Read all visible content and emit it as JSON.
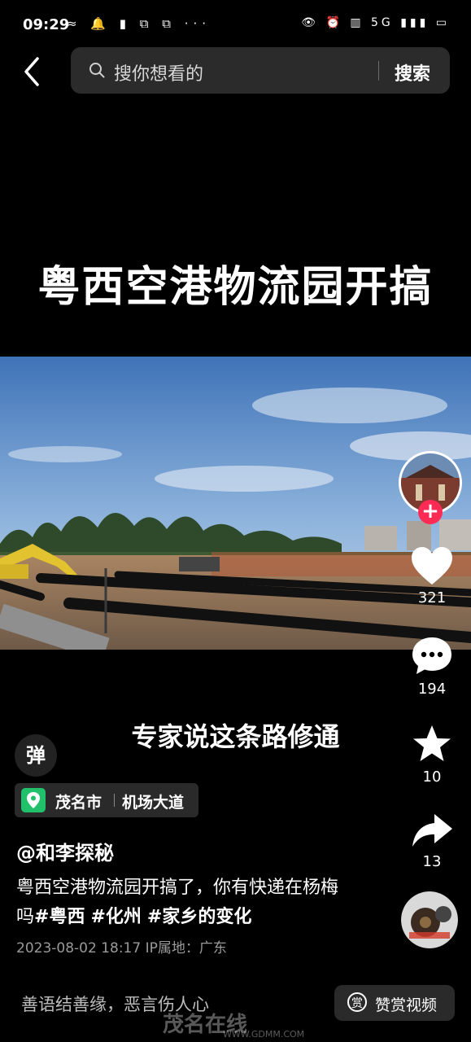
{
  "status_bar": {
    "time": "09:29",
    "left_icons": "≈ 🔔 ▮ ⧉ ⧉ ···",
    "right_icons": "👁 ⏰ ▥ 5G ▮▮▮ ▭"
  },
  "top": {
    "search_placeholder": "搜你想看的",
    "search_button": "搜索"
  },
  "video": {
    "title": "粤西空港物流园开搞",
    "subtitle": "专家说这条路修通"
  },
  "actions": {
    "likes": "321",
    "comments": "194",
    "favorites": "10",
    "shares": "13"
  },
  "danmu_label": "弹",
  "location": {
    "city": "茂名市",
    "road": "机场大道"
  },
  "author": "@和李探秘",
  "description": {
    "text": "粤西空港物流园开搞了，你有快递在杨梅吗",
    "tags": [
      "#粤西",
      "#化州",
      "#家乡的变化"
    ]
  },
  "meta": "2023-08-02 18:17  IP属地：广东",
  "bottom": {
    "slogan": "善语结善缘，恶言伤人心",
    "reward_icon": "赏",
    "reward_label": "赞赏视频"
  },
  "watermark": {
    "brand": "茂名在线",
    "url": "WWW.GDMM.COM"
  },
  "colors": {
    "follow": "#fe2c55",
    "pin": "#20c16a"
  }
}
